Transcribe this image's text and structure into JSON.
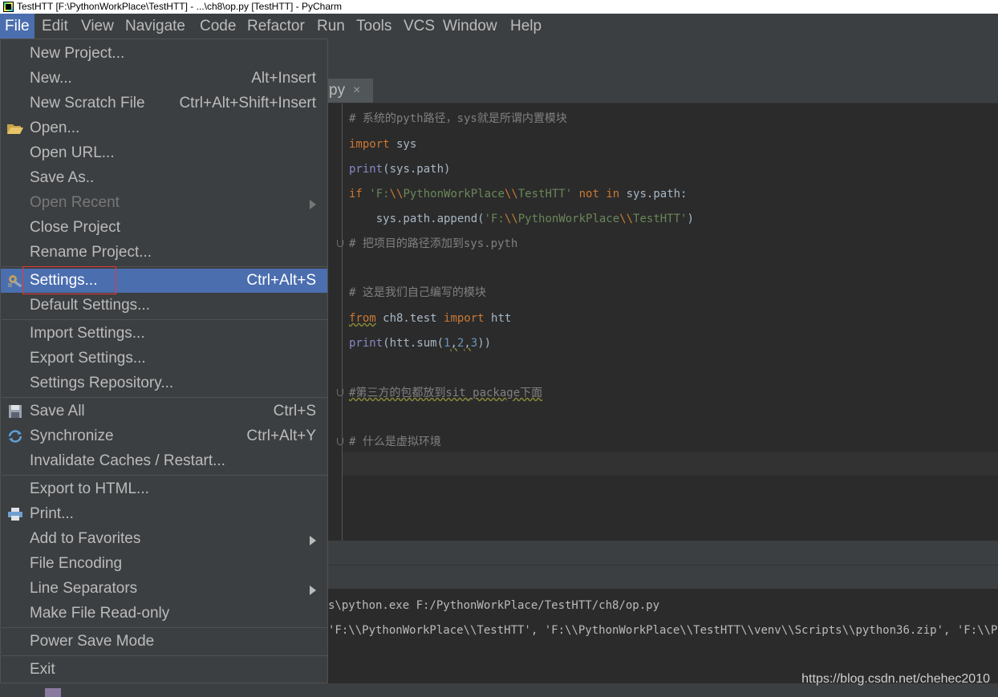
{
  "window": {
    "title": "TestHTT [F:\\PythonWorkPlace\\TestHTT] - ...\\ch8\\op.py [TestHTT] - PyCharm"
  },
  "menubar": {
    "items": [
      {
        "label": "File"
      },
      {
        "label": "Edit"
      },
      {
        "label": "View"
      },
      {
        "label": "Navigate"
      },
      {
        "label": "Code"
      },
      {
        "label": "Refactor"
      },
      {
        "label": "Run"
      },
      {
        "label": "Tools"
      },
      {
        "label": "VCS"
      },
      {
        "label": "Window"
      },
      {
        "label": "Help"
      }
    ],
    "active": "File"
  },
  "editor_tab": {
    "label": "py",
    "close": "×"
  },
  "file_menu": {
    "items": [
      {
        "label": "New Project...",
        "shortcut": ""
      },
      {
        "label": "New...",
        "shortcut": "Alt+Insert"
      },
      {
        "label": "New Scratch File",
        "shortcut": "Ctrl+Alt+Shift+Insert"
      },
      {
        "label": "Open...",
        "shortcut": "",
        "icon": "folder-open-icon"
      },
      {
        "label": "Open URL...",
        "shortcut": ""
      },
      {
        "label": "Save As..",
        "shortcut": ""
      },
      {
        "label": "Open Recent",
        "shortcut": "",
        "disabled": true,
        "submenu": true
      },
      {
        "label": "Close Project",
        "shortcut": ""
      },
      {
        "label": "Rename Project...",
        "shortcut": ""
      },
      {
        "label": "Settings...",
        "shortcut": "Ctrl+Alt+S",
        "selected": true,
        "icon": "wrench-icon"
      },
      {
        "label": "Default Settings...",
        "shortcut": ""
      },
      {
        "label": "Import Settings...",
        "shortcut": ""
      },
      {
        "label": "Export Settings...",
        "shortcut": ""
      },
      {
        "label": "Settings Repository...",
        "shortcut": ""
      },
      {
        "label": "Save All",
        "shortcut": "Ctrl+S",
        "icon": "floppy-disk-icon"
      },
      {
        "label": "Synchronize",
        "shortcut": "Ctrl+Alt+Y",
        "icon": "sync-icon"
      },
      {
        "label": "Invalidate Caches / Restart...",
        "shortcut": ""
      },
      {
        "label": "Export to HTML...",
        "shortcut": ""
      },
      {
        "label": "Print...",
        "shortcut": "",
        "icon": "printer-icon"
      },
      {
        "label": "Add to Favorites",
        "shortcut": "",
        "submenu": true
      },
      {
        "label": "File Encoding",
        "shortcut": ""
      },
      {
        "label": "Line Separators",
        "shortcut": "",
        "submenu": true
      },
      {
        "label": "Make File Read-only",
        "shortcut": ""
      },
      {
        "label": "Power Save Mode",
        "shortcut": ""
      },
      {
        "label": "Exit",
        "shortcut": ""
      }
    ]
  },
  "code": {
    "l1_comment": "# 系统的pyth路径，sys就是所谓内置模块",
    "l2_kw": "import",
    "l2_rest": " sys",
    "l3_fn": "print",
    "l3_rest": "(sys.path)",
    "l4_if": "if",
    "l4_str1": " 'F:",
    "l4_esc1": "\\\\",
    "l4_str2": "PythonWorkPlace",
    "l4_esc2": "\\\\",
    "l4_str3": "TestHTT'",
    "l4_not": " not",
    "l4_in": " in",
    "l4_rest": " sys.path:",
    "l5_pre": "    sys.path.append(",
    "l5_str1": "'F:",
    "l5_esc1": "\\\\",
    "l5_str2": "PythonWorkPlace",
    "l5_esc2": "\\\\",
    "l5_str3": "TestHTT'",
    "l5_post": ")",
    "l6_comment": "# 把项目的路径添加到sys.pyth",
    "l8_comment": "# 这是我们自己编写的模块",
    "l9_from": "from",
    "l9_mid": " ch8.test ",
    "l9_import": "import",
    "l9_rest": " htt",
    "l10_fn": "print",
    "l10_pre": "(htt.sum(",
    "l10_n1": "1",
    "l10_c1": ",",
    "l10_n2": "2",
    "l10_c2": ",",
    "l10_n3": "3",
    "l10_post": "))",
    "l12_comment": "#第三方的包都放到sit_package下面",
    "l14_comment": "# 什么是虚拟环境"
  },
  "console": {
    "line1": "s\\python.exe F:/PythonWorkPlace/TestHTT/ch8/op.py",
    "line2": "'F:\\\\PythonWorkPlace\\\\TestHTT', 'F:\\\\PythonWorkPlace\\\\TestHTT\\\\venv\\\\Scripts\\\\python36.zip', 'F:\\\\PythonW"
  },
  "watermark": "https://blog.csdn.net/chehec2010"
}
